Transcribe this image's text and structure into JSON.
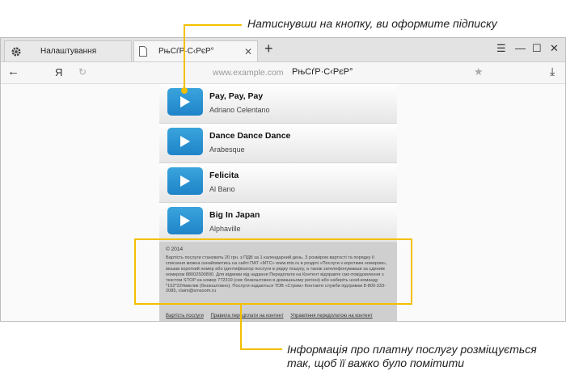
{
  "callouts": {
    "top": "Натиснувши на кнопку, ви оформите підписку",
    "bottom": "Інформація про платну послугу розміщується так, щоб її важко було помітити"
  },
  "browser": {
    "tabs": [
      {
        "label": "Налаштування",
        "icon": "gear-icon"
      },
      {
        "label": "РњСѓР·С‹РєР°",
        "icon": "document-icon",
        "active": true
      }
    ],
    "new_tab": "+",
    "window_controls": [
      "menu-icon",
      "minimize-icon",
      "maximize-icon",
      "close-icon"
    ],
    "address": {
      "back": "←",
      "yandex": "Я",
      "domain": "www.example.com",
      "page_title": "РњСѓР·С‹РєР°"
    }
  },
  "songs": [
    {
      "title": "Pay, Pay, Pay",
      "artist": "Adriano Celentano"
    },
    {
      "title": "Dance Dance Dance",
      "artist": "Arabesque"
    },
    {
      "title": "Felicita",
      "artist": "Al Bano"
    },
    {
      "title": "Big In Japan",
      "artist": "Alphaville"
    }
  ],
  "footer": {
    "copyright": "© 2014",
    "legal_text": "Вартість послуги становить 20 грн. з ПДВ за 1 календарний день. З розміром вартості та порядку її списання можна ознайомитись на сайті ПАТ «МТС» www.mts.ru в розділі «Послуги з коротким номером», вказав короткий номер або ідентифікатор послуги в рядку пошуку, а також зателефонувавши за єдиним номером 88002500890. Для відмови від надання Передплати на Контент відправте смс-повідомлення з текстом STOP на номер 772319 (смс безкоштовно в домашньому регіоні) або наберіть ussd-команду *152*22#виклик (безкоштовно). Послуги надаються ТОВ «Стрим» Контакти служби підтримки 8-800-333-2085, claim@smsoom.ru",
    "links": [
      "Вартість послуги",
      "Правила передплати на контент",
      "Управління передплатою на контент"
    ]
  },
  "colors": {
    "accent": "#f3c000",
    "play_button": "#2a95d6"
  }
}
